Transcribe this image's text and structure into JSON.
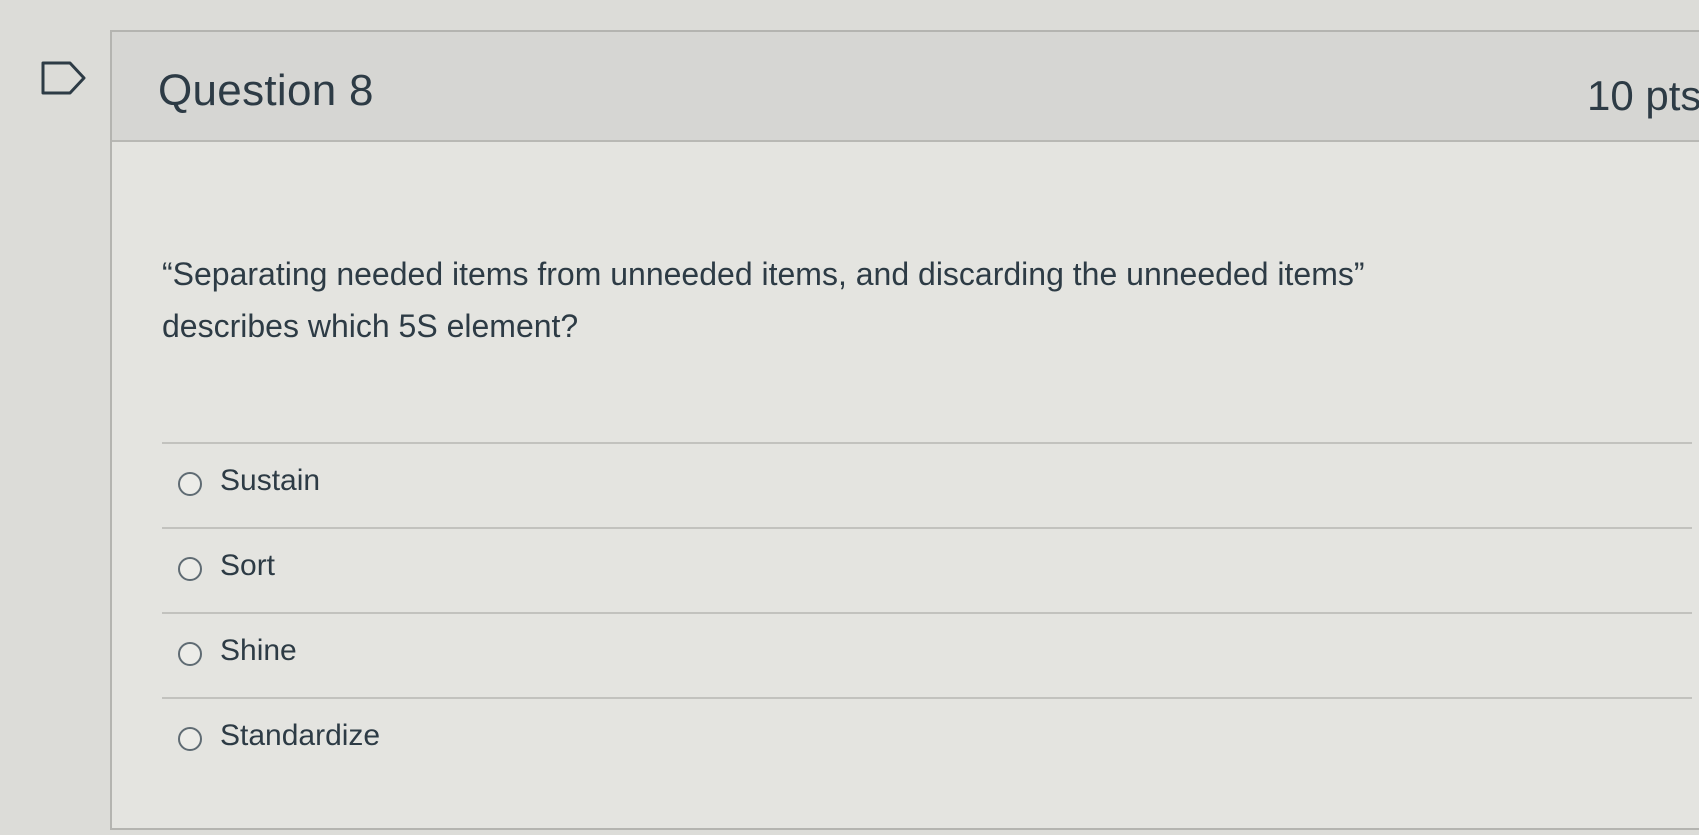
{
  "question": {
    "title": "Question 8",
    "points": "10 pts",
    "text": "“Separating needed items from unneeded items, and discarding the unneeded items” describes which 5S element?"
  },
  "answers": [
    {
      "label": "Sustain",
      "selected": false
    },
    {
      "label": "Sort",
      "selected": false
    },
    {
      "label": "Shine",
      "selected": false
    },
    {
      "label": "Standardize",
      "selected": false
    }
  ],
  "icons": {
    "flag": "flag-question-icon",
    "radio": "radio-button-icon"
  },
  "colors": {
    "text": "#2d3b45",
    "header_bg": "#d6d6d3",
    "card_bg": "#e4e4e0"
  }
}
